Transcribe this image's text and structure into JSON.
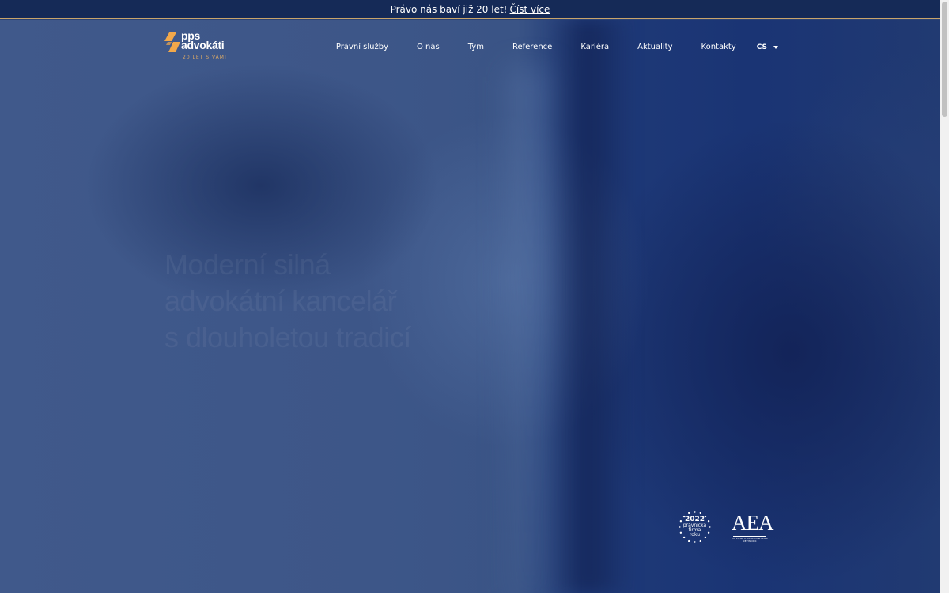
{
  "topbar": {
    "text": "Právo nás baví již 20 let!",
    "link": "Číst více"
  },
  "logo": {
    "line1": "pps",
    "line2": "advokáti",
    "tagline": "20 LET S VÁMI",
    "accent_color": "#f2a84a"
  },
  "nav": {
    "items": [
      {
        "label": "Právní služby"
      },
      {
        "label": "O nás"
      },
      {
        "label": "Tým"
      },
      {
        "label": "Reference"
      },
      {
        "label": "Kariéra"
      },
      {
        "label": "Aktuality"
      },
      {
        "label": "Kontakty"
      }
    ],
    "language": "CS"
  },
  "hero": {
    "headline": [
      "Moderní silná",
      "advokátní kancelář",
      "s dlouholetou tradicí"
    ]
  },
  "badges": {
    "award": {
      "year": "2022",
      "line1": "právnická",
      "line2": "firma",
      "line3": "roku"
    },
    "aea": {
      "title": "AEA",
      "subtitle": "INTERNATIONAL LAWYERS NETWORK"
    }
  },
  "colors": {
    "topbar_bg": "#152a57",
    "hero_bg": "#2a4273",
    "gold": "#c9a46a"
  }
}
